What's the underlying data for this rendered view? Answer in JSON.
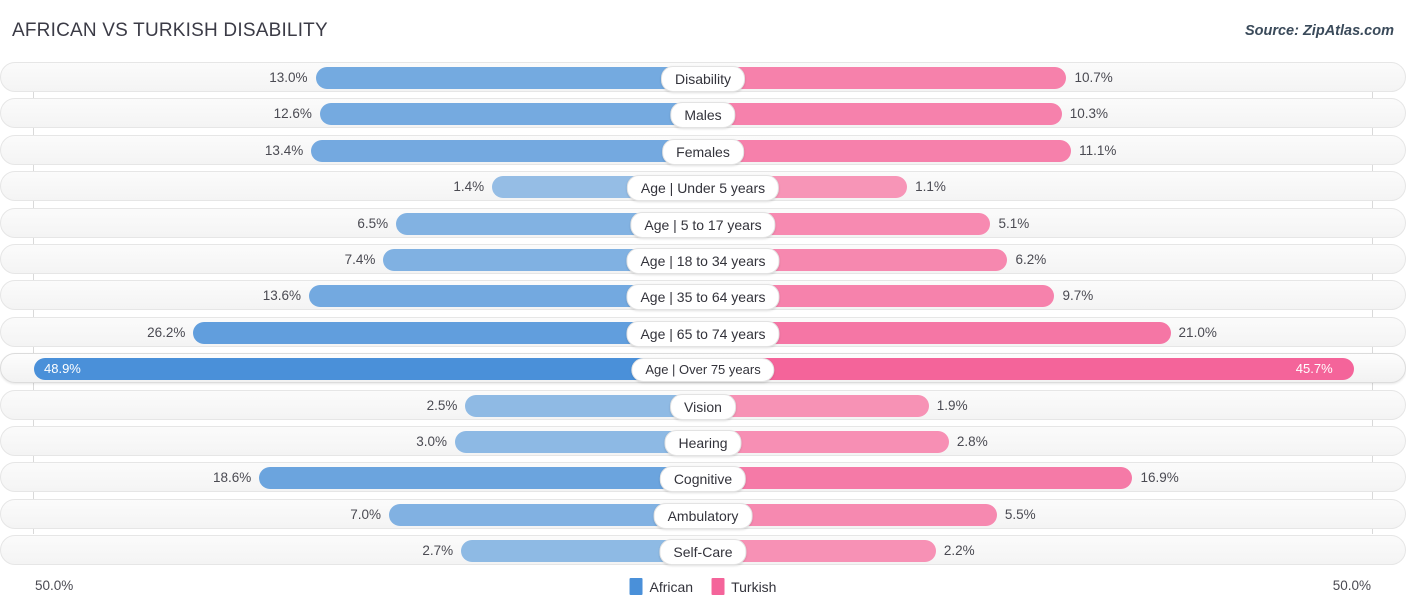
{
  "header": {
    "title": "AFRICAN VS TURKISH DISABILITY",
    "source": "Source: ZipAtlas.com"
  },
  "axis": {
    "left_label": "50.0%",
    "right_label": "50.0%",
    "max": 50.0
  },
  "legend": {
    "items": [
      {
        "label": "African",
        "color": "#4a90d9"
      },
      {
        "label": "Turkish",
        "color": "#f4649a"
      }
    ]
  },
  "chart_data": {
    "type": "bar",
    "orientation": "diverging-horizontal",
    "title": "AFRICAN VS TURKISH DISABILITY",
    "xlabel": "",
    "ylabel": "",
    "xlim": [
      50.0,
      50.0
    ],
    "grid": true,
    "legend_position": "bottom-center",
    "categories": [
      "Disability",
      "Males",
      "Females",
      "Age | Under 5 years",
      "Age | 5 to 17 years",
      "Age | 18 to 34 years",
      "Age | 35 to 64 years",
      "Age | 65 to 74 years",
      "Age | Over 75 years",
      "Vision",
      "Hearing",
      "Cognitive",
      "Ambulatory",
      "Self-Care"
    ],
    "series": [
      {
        "name": "African",
        "color": "#4a90d9",
        "values": [
          13.0,
          12.6,
          13.4,
          1.4,
          6.5,
          7.4,
          13.6,
          26.2,
          48.9,
          2.5,
          3.0,
          18.6,
          7.0,
          2.7
        ]
      },
      {
        "name": "Turkish",
        "color": "#f4649a",
        "values": [
          10.7,
          10.3,
          11.1,
          1.1,
          5.1,
          6.2,
          9.7,
          21.0,
          45.7,
          1.9,
          2.8,
          16.9,
          5.5,
          2.2
        ]
      }
    ],
    "value_labels": {
      "African": [
        "13.0%",
        "12.6%",
        "13.4%",
        "1.4%",
        "6.5%",
        "7.4%",
        "13.6%",
        "26.2%",
        "48.9%",
        "2.5%",
        "3.0%",
        "18.6%",
        "7.0%",
        "2.7%"
      ],
      "Turkish": [
        "10.7%",
        "10.3%",
        "11.1%",
        "1.1%",
        "5.1%",
        "6.2%",
        "9.7%",
        "21.0%",
        "45.7%",
        "1.9%",
        "2.8%",
        "16.9%",
        "5.5%",
        "2.2%"
      ]
    },
    "highlighted_row": "Age | Over 75 years"
  }
}
